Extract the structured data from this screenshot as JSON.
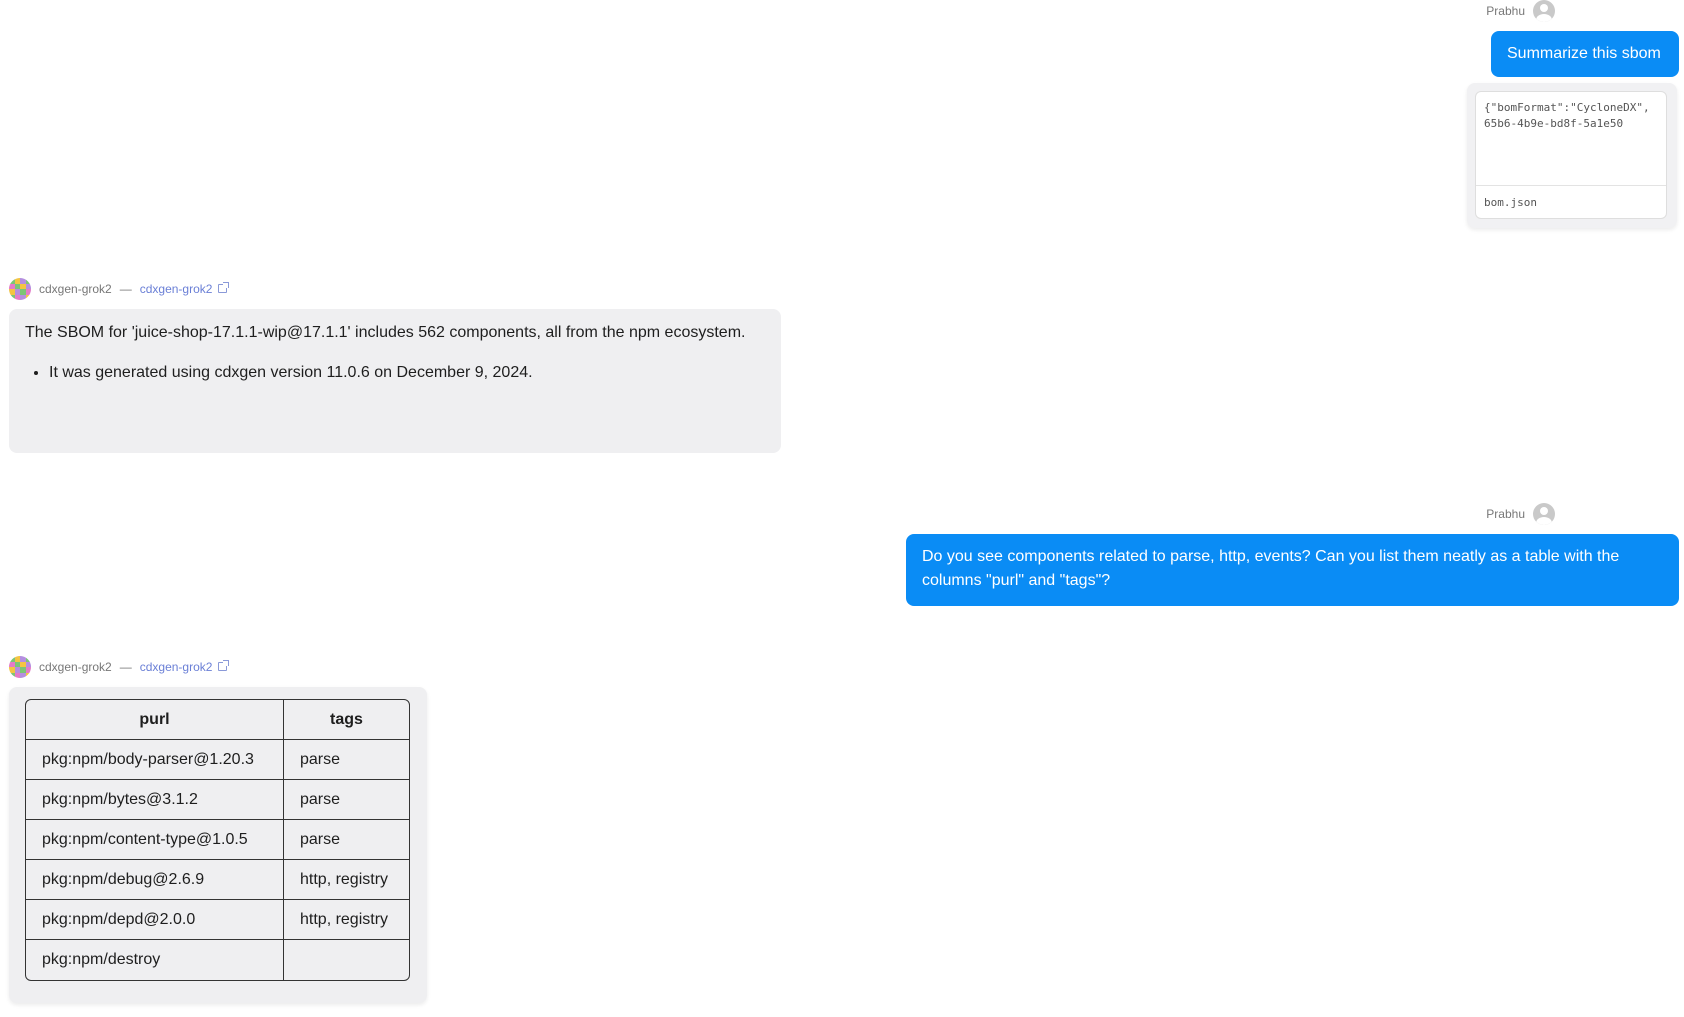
{
  "user_name": "Prabhu",
  "messages": {
    "user_1": {
      "text": "Summarize this sbom",
      "attachment": {
        "preview_line1": "{\"bomFormat\":\"CycloneDX\",",
        "preview_line2": "65b6-4b9e-bd8f-5a1e50",
        "filename": "bom.json"
      }
    },
    "assistant_1": {
      "model_name": "cdxgen-grok2",
      "separator": "—",
      "model_link": "cdxgen-grok2",
      "paragraph": "The SBOM for 'juice-shop-17.1.1-wip@17.1.1' includes 562 components, all from the npm ecosystem.",
      "bullets": [
        "It was generated using cdxgen version 11.0.6 on December 9, 2024."
      ]
    },
    "user_2": {
      "text": "Do you see components related to parse, http, events? Can you list them neatly as a table with the columns \"purl\" and \"tags\"?"
    },
    "assistant_2": {
      "model_name": "cdxgen-grok2",
      "separator": "—",
      "model_link": "cdxgen-grok2",
      "table": {
        "headers": [
          "purl",
          "tags"
        ],
        "rows": [
          [
            "pkg:npm/body-parser@1.20.3",
            "parse"
          ],
          [
            "pkg:npm/bytes@3.1.2",
            "parse"
          ],
          [
            "pkg:npm/content-type@1.0.5",
            "parse"
          ],
          [
            "pkg:npm/debug@2.6.9",
            "http, registry"
          ],
          [
            "pkg:npm/depd@2.0.0",
            "http, registry"
          ],
          [
            "pkg:npm/destroy",
            ""
          ]
        ]
      }
    }
  },
  "colors": {
    "user_bubble": "#0a8cf5",
    "assistant_bubble": "#efeff1",
    "link": "#6a7fd6"
  }
}
